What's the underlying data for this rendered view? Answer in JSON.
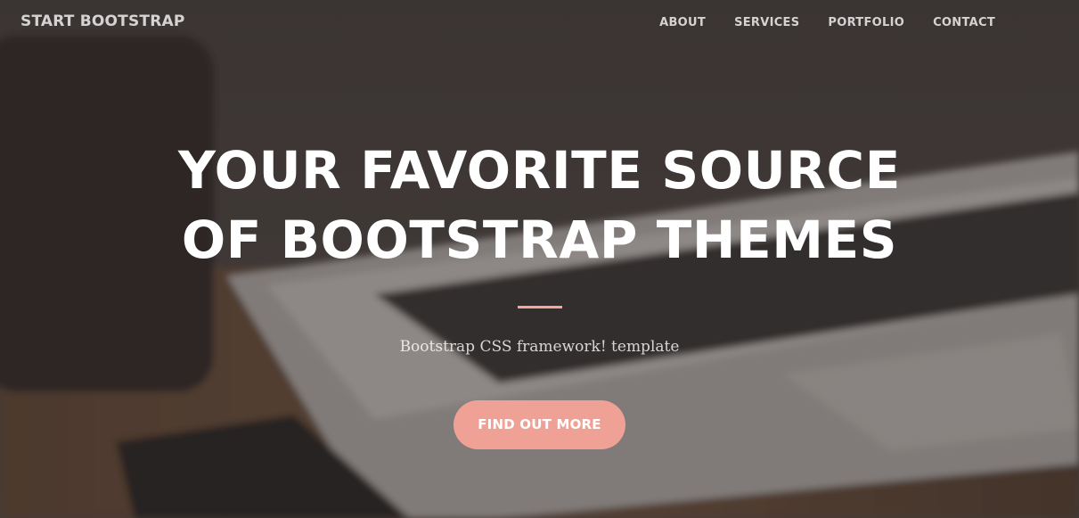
{
  "navbar": {
    "brand": "START BOOTSTRAP",
    "links": [
      "ABOUT",
      "SERVICES",
      "PORTFOLIO",
      "CONTACT"
    ]
  },
  "hero": {
    "heading": "YOUR FAVORITE SOURCE OF BOOTSTRAP THEMES",
    "subtitle": "Bootstrap CSS framework! template",
    "cta_label": "FIND OUT MORE"
  },
  "colors": {
    "accent": "#f0a196",
    "divider": "#f4a79a",
    "text": "#ffffff"
  }
}
